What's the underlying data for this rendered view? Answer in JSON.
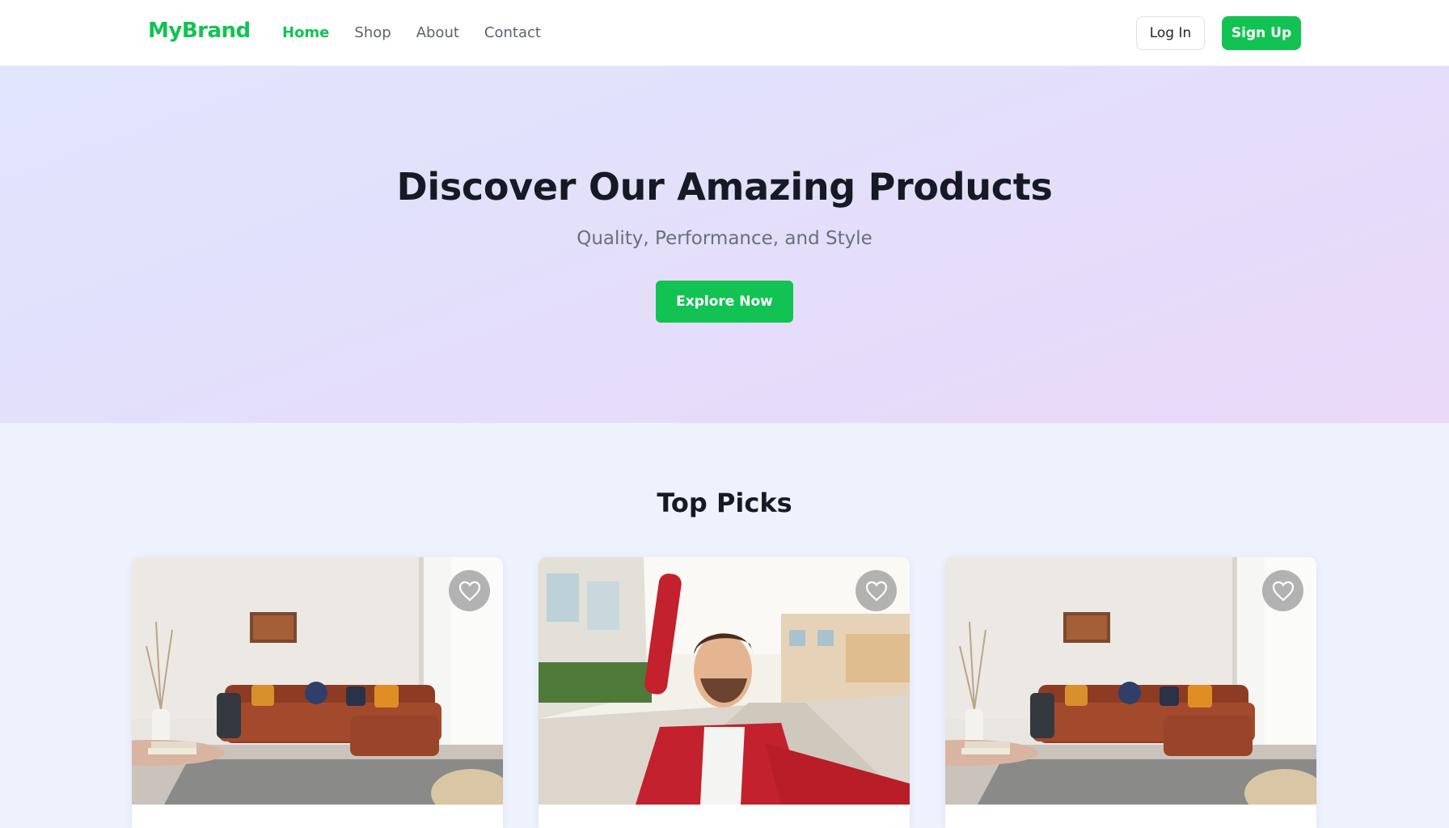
{
  "brand": "MyBrand",
  "nav": {
    "links": [
      {
        "label": "Home",
        "active": true
      },
      {
        "label": "Shop",
        "active": false
      },
      {
        "label": "About",
        "active": false
      },
      {
        "label": "Contact",
        "active": false
      }
    ],
    "login_label": "Log In",
    "signup_label": "Sign Up"
  },
  "hero": {
    "title": "Discover Our Amazing Products",
    "subtitle": "Quality, Performance, and Style",
    "cta_label": "Explore Now"
  },
  "top_picks": {
    "title": "Top Picks",
    "cards": [
      {
        "image": "living-room-sofa-photo",
        "favorite_icon": "heart-icon"
      },
      {
        "image": "smiling-man-selfie-photo",
        "favorite_icon": "heart-icon"
      },
      {
        "image": "living-room-sofa-photo",
        "favorite_icon": "heart-icon"
      }
    ]
  },
  "colors": {
    "accent": "#12c353",
    "hero_gradient_start": "#e0e5fc",
    "hero_gradient_end": "#ead9f7",
    "page_background": "#eef2fd"
  }
}
